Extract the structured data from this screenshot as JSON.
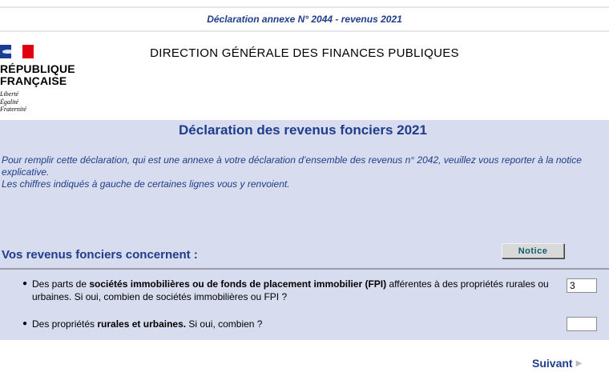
{
  "top_banner": "Déclaration annexe N° 2044 - revenus 2021",
  "logo": {
    "line1": "RÉPUBLIQUE",
    "line2": "FRANÇAISE",
    "motto": [
      "Liberté",
      "Égalité",
      "Fraternité"
    ]
  },
  "agency": "DIRECTION GÉNÉRALE DES FINANCES PUBLIQUES",
  "main_title": "Déclaration des revenus fonciers 2021",
  "intro": [
    "Pour remplir cette déclaration, qui est une annexe à votre déclaration d’ensemble des revenus n° 2042, veuillez vous reporter à la notice explicative.",
    "Les chiffres indiqués à gauche de certaines lignes vous y renvoient."
  ],
  "section_title": "Vos revenus fonciers concernent :",
  "notice_button": "Notice",
  "questions": [
    {
      "prefix": "Des parts de ",
      "bold": "sociétés immobilières ou de fonds de placement immobilier (FPI)",
      "suffix": " afférentes à des propriétés rurales ou urbaines. Si oui, combien de sociétés immobilières ou FPI ?",
      "value": "3"
    },
    {
      "prefix": "Des propriétés ",
      "bold": "rurales et urbaines.",
      "suffix": " Si oui, combien ?",
      "value": ""
    }
  ],
  "next_link": "Suivant",
  "colors": {
    "navy": "#1f3d8a",
    "panel": "#d7dcef",
    "flag_blue": "#1b3d91",
    "flag_red": "#e1000f"
  }
}
